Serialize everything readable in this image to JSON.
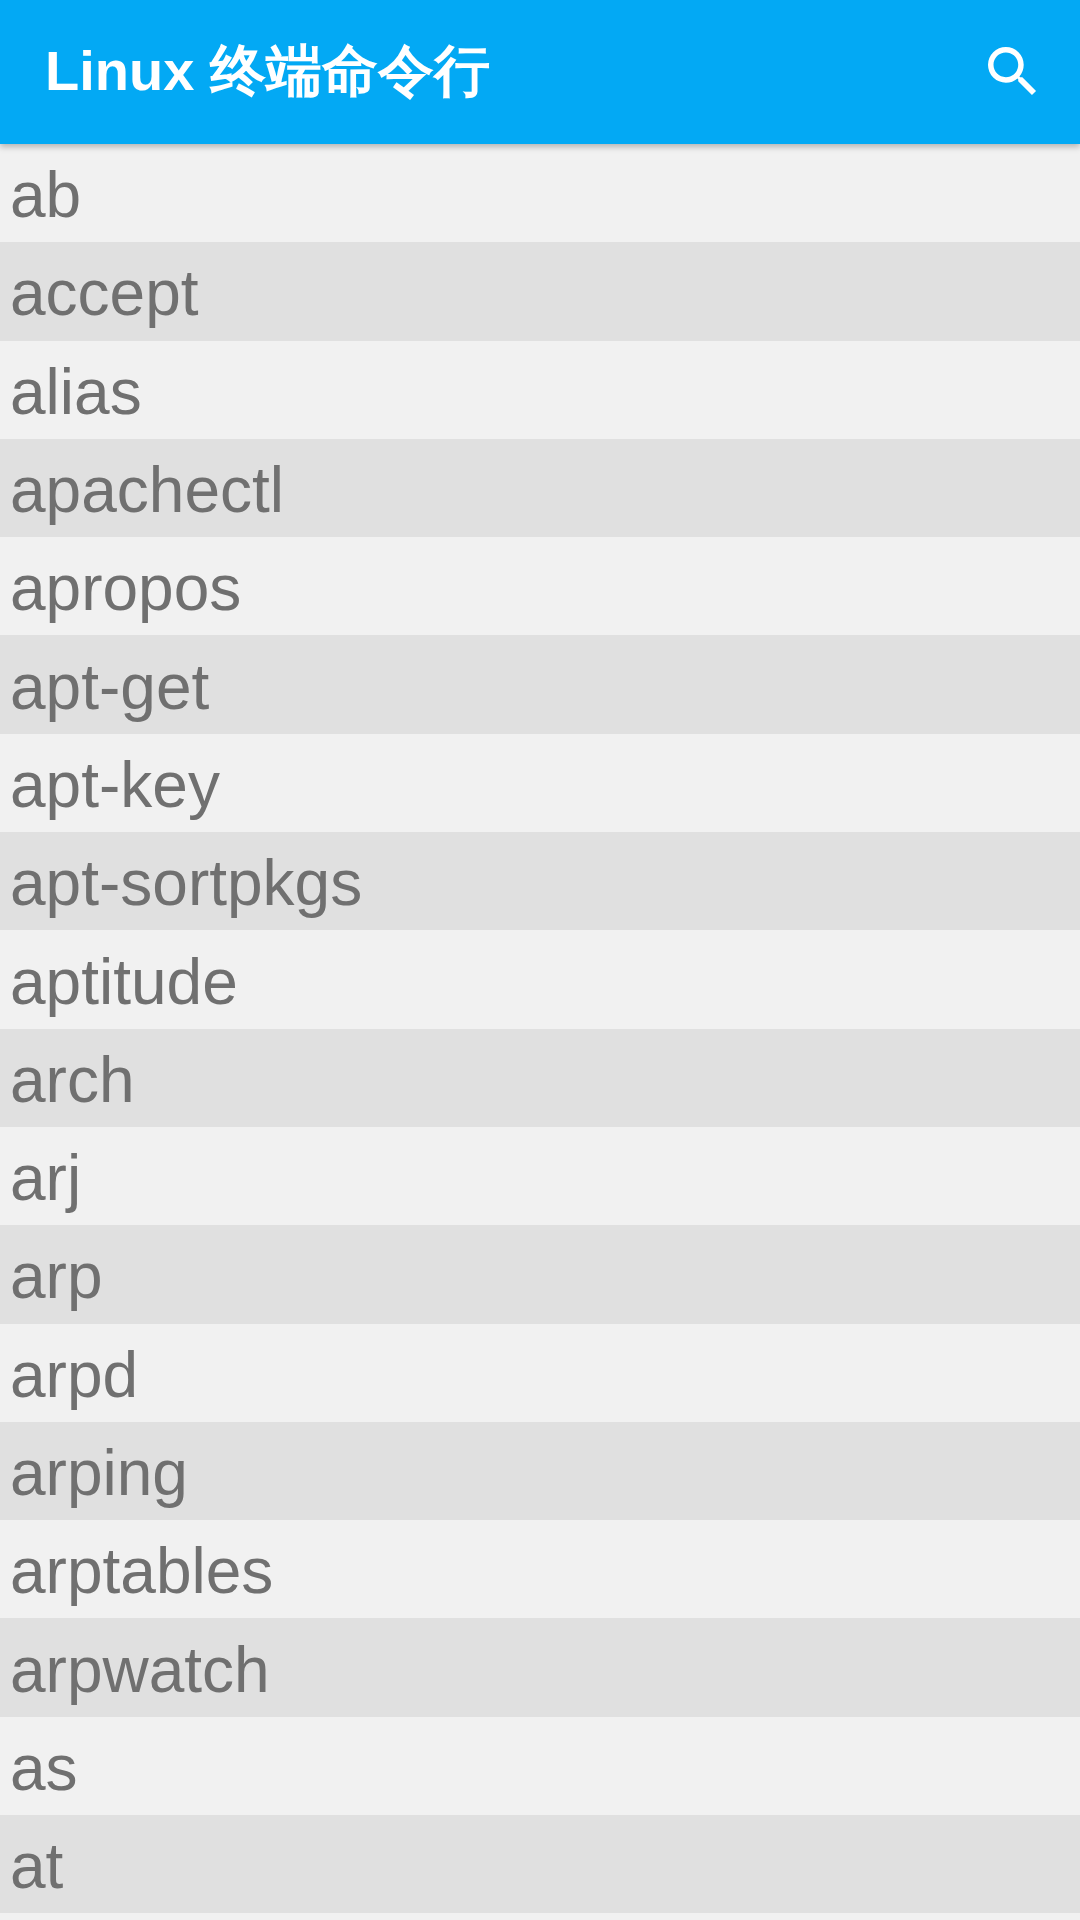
{
  "app_bar": {
    "title": "Linux 终端命令行"
  },
  "commands": [
    "ab",
    "accept",
    "alias",
    "apachectl",
    "apropos",
    "apt-get",
    "apt-key",
    "apt-sortpkgs",
    "aptitude",
    "arch",
    "arj",
    "arp",
    "arpd",
    "arping",
    "arptables",
    "arpwatch",
    "as",
    "at"
  ]
}
